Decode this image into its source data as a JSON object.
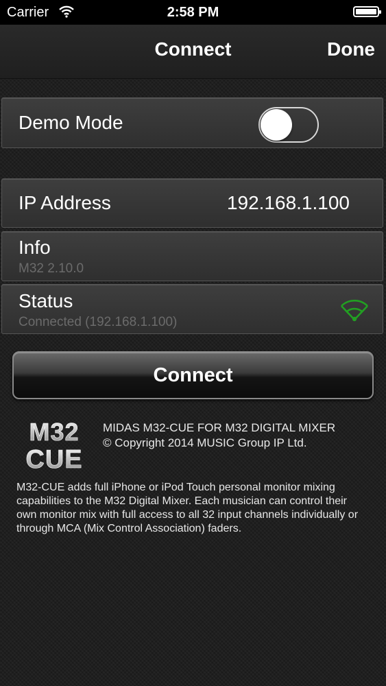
{
  "status_bar": {
    "carrier": "Carrier",
    "time": "2:58 PM",
    "icons": [
      "wifi-icon",
      "battery-icon"
    ]
  },
  "nav": {
    "title": "Connect",
    "done_label": "Done"
  },
  "demo_mode": {
    "label": "Demo Mode",
    "enabled": false
  },
  "ip_address": {
    "label": "IP Address",
    "value": "192.168.1.100"
  },
  "info": {
    "label": "Info",
    "value": "M32 2.10.0"
  },
  "status": {
    "label": "Status",
    "value": "Connected (192.168.1.100)",
    "icon": "wifi-connected-icon",
    "icon_color": "#22a022"
  },
  "connect_button": {
    "label": "Connect"
  },
  "about": {
    "logo_text": [
      "M32",
      "CUE"
    ],
    "title": "MIDAS M32-CUE FOR M32 DIGITAL MIXER",
    "copyright": "© Copyright 2014 MUSIC Group IP Ltd.",
    "description": "M32-CUE adds full iPhone or iPod Touch personal monitor mixing capabilities to the M32 Digital Mixer. Each musician can control their own monitor mix with full access to all 32 input channels individually or through MCA (Mix Control Association) faders."
  }
}
